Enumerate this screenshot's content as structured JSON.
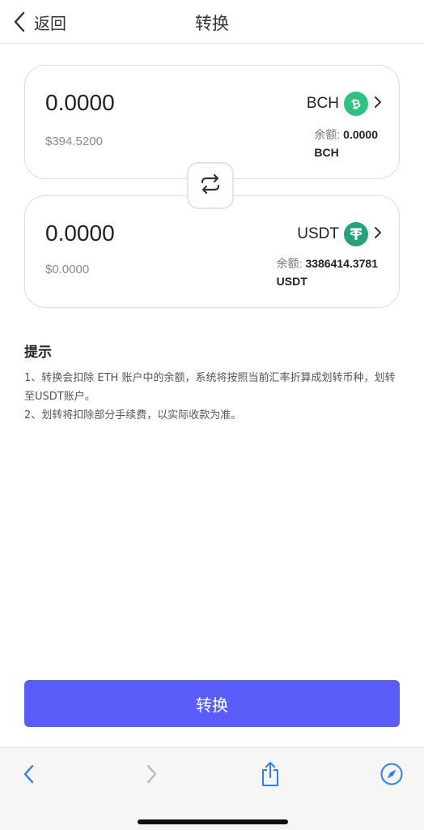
{
  "header": {
    "back_label": "返回",
    "title": "转换"
  },
  "from_card": {
    "amount": "0.0000",
    "fiat_value": "$394.5200",
    "token": "BCH",
    "balance_label": "余额:",
    "balance_value": "0.0000",
    "balance_unit": "BCH",
    "icon": "bch-coin-icon"
  },
  "to_card": {
    "amount": "0.0000",
    "fiat_value": "$0.0000",
    "token": "USDT",
    "balance_label": "余额:",
    "balance_value": "3386414.3781",
    "balance_unit": "USDT",
    "icon": "usdt-coin-icon"
  },
  "tips": {
    "title": "提示",
    "line1": "1、转换会扣除 ETH 账户中的余额，系统将按照当前汇率折算成划转币种，划转至USDT账户。",
    "line2": "2、划转将扣除部分手续费，以实际收款为准。"
  },
  "submit_label": "转换",
  "colors": {
    "accent": "#5b5dfa",
    "bch": "#2ec27e",
    "usdt": "#26a17b",
    "browser_blue": "#2f7cf6"
  }
}
